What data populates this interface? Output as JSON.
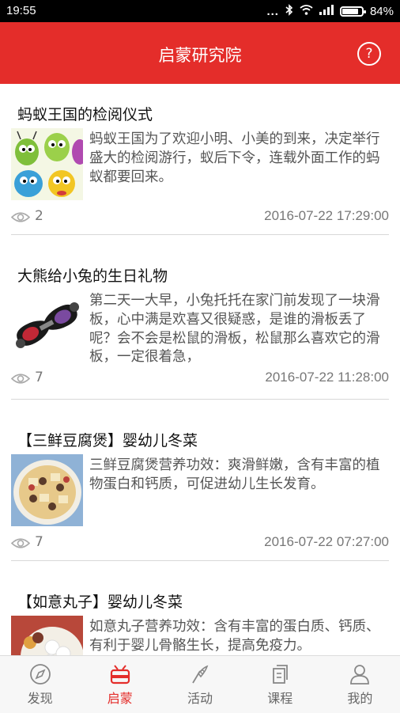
{
  "status_bar": {
    "time": "19:55",
    "signal_dots": "...",
    "battery_level": 84,
    "battery_text": "84%"
  },
  "header": {
    "title": "启蒙研究院",
    "help_icon": "?"
  },
  "articles": [
    {
      "title": "蚂蚁王国的检阅仪式",
      "summary": "蚂蚁王国为了欢迎小明、小美的到来，决定举行盛大的检阅游行，蚁后下令，连载外面工作的蚂蚁都要回来。",
      "views": "2",
      "date": "2016-07-22 17:29:00",
      "thumbnail": "cartoon-ants"
    },
    {
      "title": "大熊给小兔的生日礼物",
      "summary": "第二天一大早，小兔托托在家门前发现了一块滑板，心中满是欢喜又很疑惑，是谁的滑板丢了呢？会不会是松鼠的滑板，松鼠那么喜欢它的滑板，一定很着急，",
      "views": "7",
      "date": "2016-07-22 11:28:00",
      "thumbnail": "skateboard"
    },
    {
      "title": "【三鲜豆腐煲】婴幼儿冬菜",
      "summary": "三鲜豆腐煲营养功效：爽滑鲜嫩，含有丰富的植物蛋白和钙质，可促进幼儿生长发育。",
      "views": "7",
      "date": "2016-07-22 07:27:00",
      "thumbnail": "tofu-dish"
    },
    {
      "title": "【如意丸子】婴幼儿冬菜",
      "summary": "如意丸子营养功效：含有丰富的蛋白质、钙质、有利于婴儿骨骼生长，提高免疫力。",
      "views": "",
      "date": "",
      "thumbnail": "meatball-dish"
    }
  ],
  "tabs": [
    {
      "label": "发现",
      "icon": "compass-icon",
      "active": false
    },
    {
      "label": "启蒙",
      "icon": "robot-icon",
      "active": true
    },
    {
      "label": "活动",
      "icon": "flag-icon",
      "active": false
    },
    {
      "label": "课程",
      "icon": "book-icon",
      "active": false
    },
    {
      "label": "我的",
      "icon": "person-icon",
      "active": false
    }
  ],
  "colors": {
    "brand": "#e42d2a",
    "text": "#111111",
    "muted": "#777777"
  }
}
